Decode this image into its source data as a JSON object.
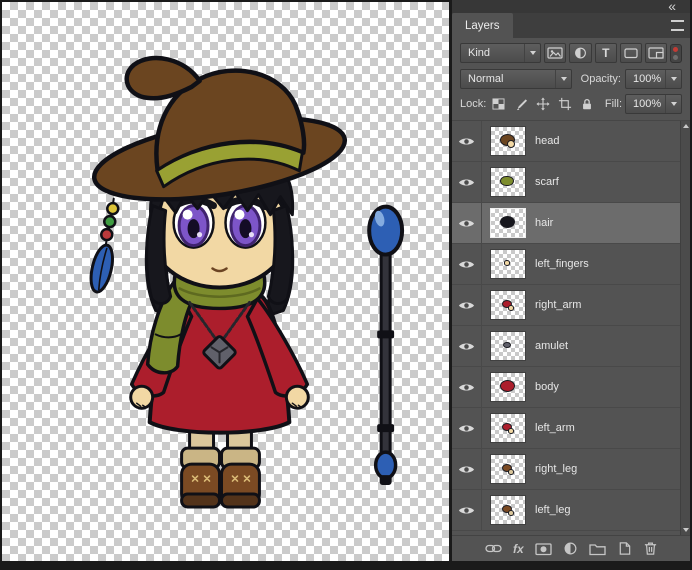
{
  "canvas": {
    "alt": "chibi witch character sprite and separate blue-orb staff on transparent checkerboard",
    "colors": {
      "hat": "#6b4520",
      "hat_band": "#99a133",
      "dress": "#ac1e2c",
      "scarf": "#7d8c2d",
      "skin": "#f2d8a4",
      "hair": "#17171d",
      "eyes": "#7d55c8",
      "staff_orb": "#2d5fb4",
      "boots": "#7b4a23",
      "socks": "#dbc79c",
      "feather": "#2d5fb4"
    }
  },
  "panel": {
    "header": {
      "collapse_glyph": "«",
      "tab_label": "Layers"
    },
    "filter_bar": {
      "kind_label": "Kind",
      "type_filter_glyph": "T"
    },
    "blend_bar": {
      "blend_mode": "Normal",
      "opacity_label": "Opacity:",
      "opacity_value": "100%"
    },
    "lock_bar": {
      "lock_label": "Lock:",
      "fill_label": "Fill:",
      "fill_value": "100%"
    },
    "layers": [
      {
        "label": "head",
        "visible": true,
        "selected": false,
        "thumb_colors": [
          "#6b4520",
          "#f2d8a4"
        ],
        "thumb_scale": 1
      },
      {
        "label": "scarf",
        "visible": true,
        "selected": false,
        "thumb_colors": [
          "#7d8c2d"
        ],
        "thumb_scale": 0.9
      },
      {
        "label": "hair",
        "visible": true,
        "selected": true,
        "thumb_colors": [
          "#17171d"
        ],
        "thumb_scale": 1
      },
      {
        "label": "left_fingers",
        "visible": true,
        "selected": false,
        "thumb_colors": [
          "#f2d8a4"
        ],
        "thumb_scale": 0.45
      },
      {
        "label": "right_arm",
        "visible": true,
        "selected": false,
        "thumb_colors": [
          "#ac1e2c",
          "#f2d8a4"
        ],
        "thumb_scale": 0.7
      },
      {
        "label": "amulet",
        "visible": true,
        "selected": false,
        "thumb_colors": [
          "#60606a"
        ],
        "thumb_scale": 0.5
      },
      {
        "label": "body",
        "visible": true,
        "selected": false,
        "thumb_colors": [
          "#ac1e2c"
        ],
        "thumb_scale": 1
      },
      {
        "label": "left_arm",
        "visible": true,
        "selected": false,
        "thumb_colors": [
          "#ac1e2c",
          "#f2d8a4"
        ],
        "thumb_scale": 0.7
      },
      {
        "label": "right_leg",
        "visible": true,
        "selected": false,
        "thumb_colors": [
          "#7b4a23",
          "#dbc79c"
        ],
        "thumb_scale": 0.7
      },
      {
        "label": "left_leg",
        "visible": true,
        "selected": false,
        "thumb_colors": [
          "#7b4a23",
          "#dbc79c"
        ],
        "thumb_scale": 0.7
      }
    ],
    "footer": {
      "fx_label": "fx"
    },
    "icons": [
      "collapse-panels-icon",
      "panel-menu-icon",
      "filter-pixel-layers-icon",
      "filter-adjustment-layers-icon",
      "filter-type-layers-icon",
      "filter-shape-layers-icon",
      "filter-smart-objects-icon",
      "layer-filter-toggle",
      "lock-transparent-pixels-icon",
      "lock-image-pixels-icon",
      "lock-position-icon",
      "lock-artboard-icon",
      "lock-all-icon",
      "eye-icon",
      "link-layers-icon",
      "layer-style-icon",
      "add-layer-mask-icon",
      "new-adjustment-layer-icon",
      "new-group-icon",
      "new-layer-icon",
      "delete-layer-icon"
    ]
  }
}
